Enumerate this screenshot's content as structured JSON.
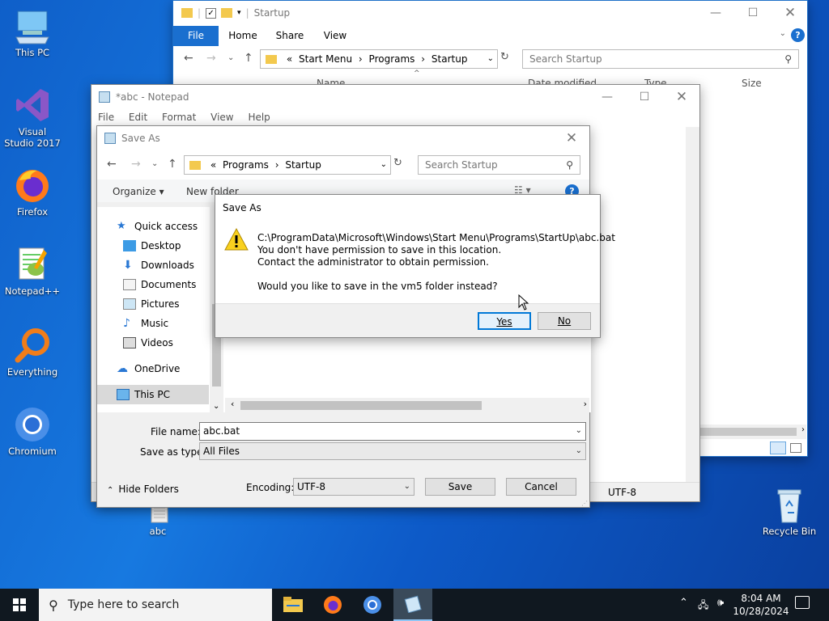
{
  "desktop": {
    "icons": [
      {
        "label": "This PC"
      },
      {
        "label": "Visual Studio 2017"
      },
      {
        "label": "Firefox"
      },
      {
        "label": "Notepad++"
      },
      {
        "label": "Everything"
      },
      {
        "label": "Chromium"
      },
      {
        "label": "abc"
      },
      {
        "label": "Recycle Bin"
      }
    ]
  },
  "explorer": {
    "title": "Startup",
    "tabs": [
      "File",
      "Home",
      "Share",
      "View"
    ],
    "breadcrumb": [
      "«",
      "Start Menu",
      "Programs",
      "Startup"
    ],
    "search_placeholder": "Search Startup",
    "columns": [
      "Name",
      "Date modified",
      "Type",
      "Size"
    ]
  },
  "notepad": {
    "title": "*abc - Notepad",
    "menu": [
      "File",
      "Edit",
      "Format",
      "View",
      "Help"
    ],
    "status_encoding": "UTF-8"
  },
  "saveas": {
    "title": "Save As",
    "breadcrumb": [
      "«",
      "Programs",
      "Startup"
    ],
    "search_placeholder": "Search Startup",
    "organize": "Organize ▾",
    "new_folder": "New folder",
    "nav": [
      {
        "label": "Quick access"
      },
      {
        "label": "Desktop"
      },
      {
        "label": "Downloads"
      },
      {
        "label": "Documents"
      },
      {
        "label": "Pictures"
      },
      {
        "label": "Music"
      },
      {
        "label": "Videos"
      },
      {
        "label": "OneDrive"
      },
      {
        "label": "This PC"
      }
    ],
    "filename_label": "File name:",
    "filename_value": "abc.bat",
    "savetype_label": "Save as type:",
    "savetype_value": "All Files",
    "hide_folders": "Hide Folders",
    "encoding_label": "Encoding:",
    "encoding_value": "UTF-8",
    "save_button": "Save",
    "cancel_button": "Cancel"
  },
  "alert": {
    "title": "Save As",
    "path": "C:\\ProgramData\\Microsoft\\Windows\\Start Menu\\Programs\\StartUp\\abc.bat",
    "line1": "You don't have permission to save in this location.",
    "line2": "Contact the administrator to obtain permission.",
    "question": "Would you like to save in the vm5 folder instead?",
    "yes": "Yes",
    "no": "No"
  },
  "taskbar": {
    "search_placeholder": "Type here to search",
    "time": "8:04 AM",
    "date": "10/28/2024"
  }
}
